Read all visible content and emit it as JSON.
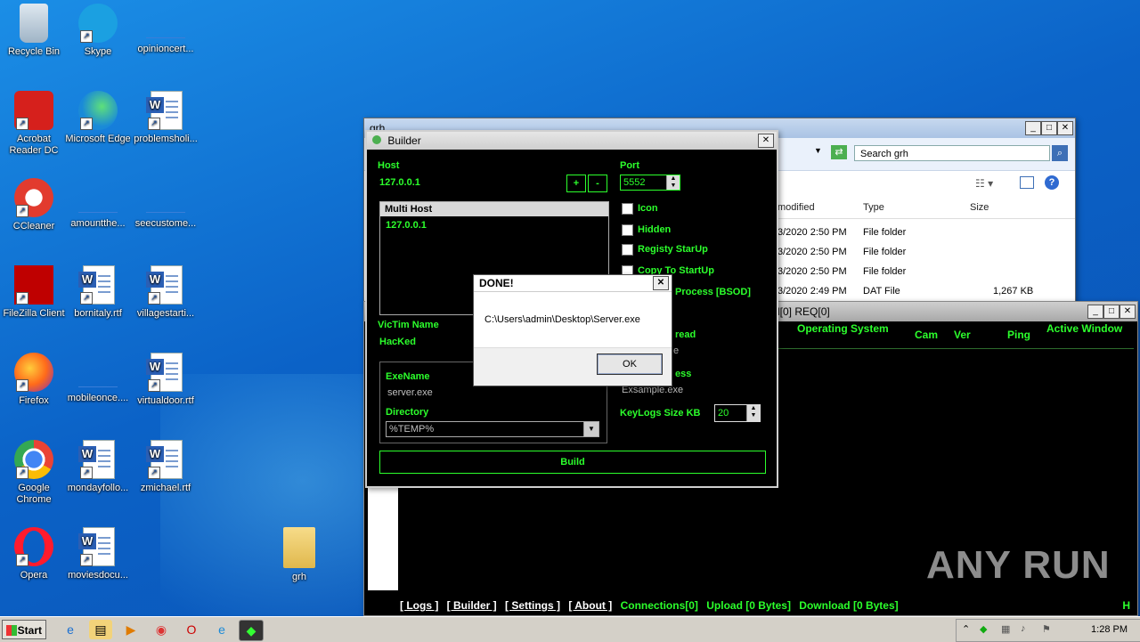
{
  "desktop": {
    "icons": [
      {
        "label": "Recycle Bin",
        "icon": "recycle-bin-icon"
      },
      {
        "label": "Skype",
        "icon": "skype-icon"
      },
      {
        "label": "opinioncert...",
        "icon": "blank-file-icon"
      },
      {
        "label": "Acrobat Reader DC",
        "icon": "acrobat-icon"
      },
      {
        "label": "Microsoft Edge",
        "icon": "edge-icon"
      },
      {
        "label": "problemsholi...",
        "icon": "word-doc-icon"
      },
      {
        "label": "CCleaner",
        "icon": "ccleaner-icon"
      },
      {
        "label": "amountthe...",
        "icon": "blank-file-icon"
      },
      {
        "label": "seecustome...",
        "icon": "blank-file-icon"
      },
      {
        "label": "FileZilla Client",
        "icon": "filezilla-icon"
      },
      {
        "label": "bornitaly.rtf",
        "icon": "word-doc-icon"
      },
      {
        "label": "villagestarti...",
        "icon": "word-doc-icon"
      },
      {
        "label": "Firefox",
        "icon": "firefox-icon"
      },
      {
        "label": "mobileonce....",
        "icon": "blank-file-icon"
      },
      {
        "label": "virtualdoor.rtf",
        "icon": "word-doc-icon"
      },
      {
        "label": "Google Chrome",
        "icon": "chrome-icon"
      },
      {
        "label": "mondayfollo...",
        "icon": "word-doc-icon"
      },
      {
        "label": "zmichael.rtf",
        "icon": "word-doc-icon"
      },
      {
        "label": "Opera",
        "icon": "opera-icon"
      },
      {
        "label": "moviesdocu...",
        "icon": "word-doc-icon"
      },
      {
        "label": "grh",
        "icon": "folder-icon"
      }
    ],
    "watermark": "ANY RUN"
  },
  "explorer": {
    "title": "grh",
    "search_placeholder": "Search grh",
    "columns": [
      "modified",
      "Type",
      "Size"
    ],
    "rows": [
      {
        "modified": "3/2020 2:50 PM",
        "type": "File folder",
        "size": ""
      },
      {
        "modified": "3/2020 2:50 PM",
        "type": "File folder",
        "size": ""
      },
      {
        "modified": "3/2020 2:50 PM",
        "type": "File folder",
        "size": ""
      },
      {
        "modified": "3/2020 2:49 PM",
        "type": "DAT File",
        "size": "1,267 KB"
      }
    ]
  },
  "rat": {
    "title": "d[0] REQ[0]",
    "columns": [
      "Operating System",
      "Cam",
      "Ver",
      "Ping",
      "Active Window"
    ],
    "footer_links": [
      "[ Logs ]",
      "[ Builder ]",
      "[ Settings ]",
      "[ About ]"
    ],
    "connections": "Connections[0]",
    "upload": "Upload [0 Bytes]",
    "download": "Download [0 Bytes]",
    "footer_right": "H"
  },
  "builder": {
    "title": "Builder",
    "host_label": "Host",
    "host_value": "127.0.0.1",
    "add_btn": "+",
    "remove_btn": "-",
    "port_label": "Port",
    "port_value": "5552",
    "multi_host_header": "Multi Host",
    "multi_host_items": [
      "127.0.0.1"
    ],
    "options": [
      "Icon",
      "Hidden",
      "Registy StarUp",
      "Copy To StartUp",
      "Process [BSOD]"
    ],
    "option_partial_1": "read",
    "option_partial_2": "ess",
    "option_partial_3": "e",
    "victim_name_label": "VicTim Name",
    "victim_name_value": "HacKed",
    "exe_name_label": "ExeName",
    "exe_name_value": "server.exe",
    "directory_label": "Directory",
    "directory_value": "%TEMP%",
    "example_exe": "Exsample.exe",
    "keylogs_label": "KeyLogs Size KB",
    "keylogs_value": "20",
    "build_btn": "Build"
  },
  "dialog": {
    "title": "DONE!",
    "message": "C:\\Users\\admin\\Desktop\\Server.exe",
    "ok": "OK"
  },
  "taskbar": {
    "start": "Start",
    "clock": "1:28 PM"
  }
}
